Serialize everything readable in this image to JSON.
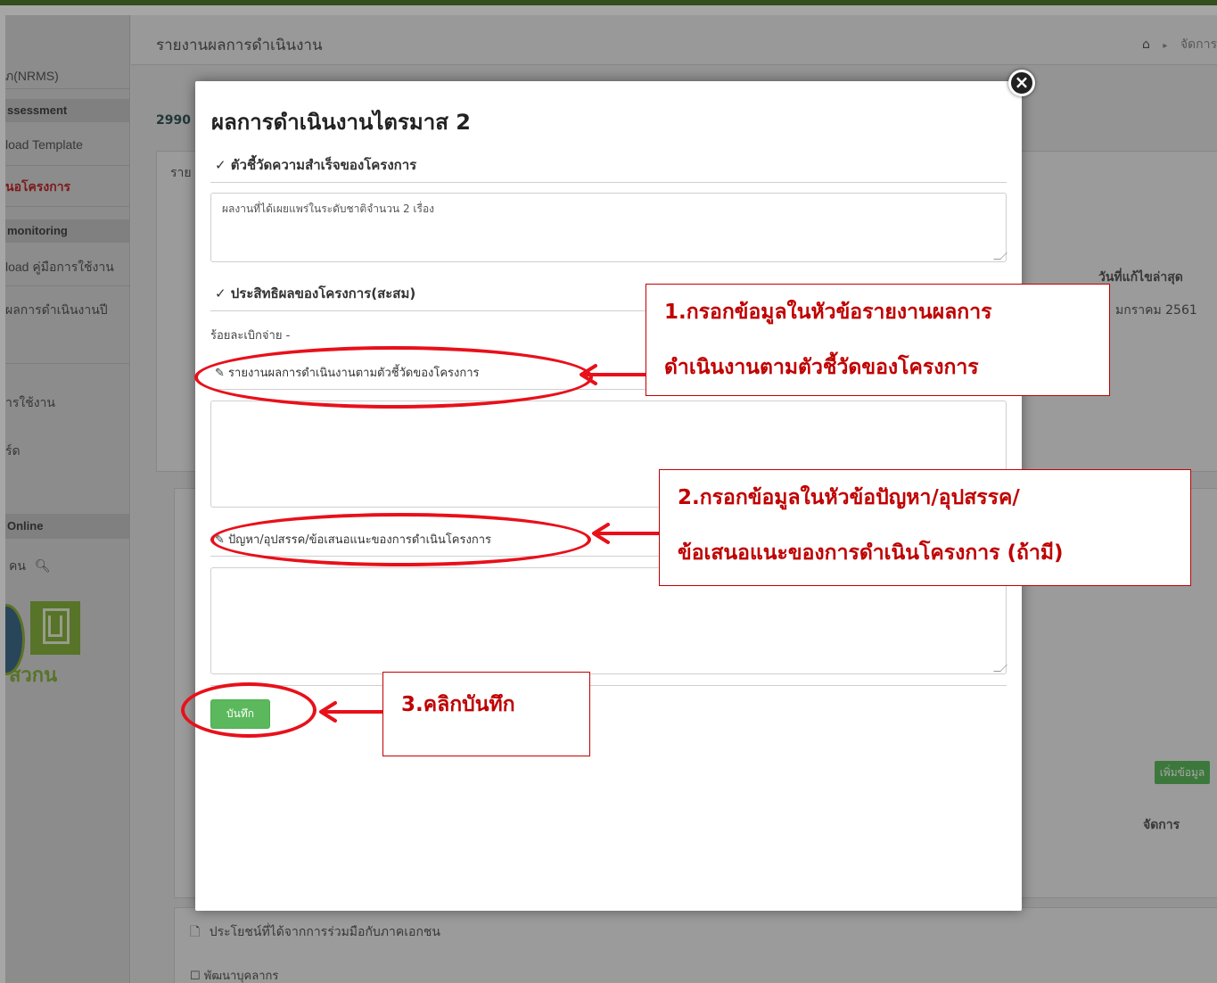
{
  "sidebar": {
    "items": [
      {
        "label": "ภ(NRMS)",
        "type": "item"
      },
      {
        "label": "ssessment",
        "type": "section"
      },
      {
        "label": "load Template",
        "type": "item"
      },
      {
        "label": "นอโครงการ",
        "type": "active"
      },
      {
        "label": "monitoring",
        "type": "section"
      },
      {
        "label": "load คู่มือการใช้งาน",
        "type": "item"
      },
      {
        "label": "ผลการดำเนินงานปี",
        "type": "item"
      },
      {
        "label": "ารใช้งาน",
        "type": "item"
      },
      {
        "label": "ร์ด",
        "type": "item"
      },
      {
        "label": "Online",
        "type": "section"
      },
      {
        "label": "คน",
        "type": "item"
      }
    ],
    "logo_text": "สวกน"
  },
  "page": {
    "title": "รายงานผลการดำเนินงาน",
    "breadcrumb": "จัดการ",
    "bg_code": "2990",
    "bg_tab": "ราย",
    "bg_col_date": "วันที่แก้ไขล่าสุด",
    "bg_date_value": "มกราคม 2561",
    "bg_col_manage": "จัดการ",
    "bg_add_button": "เพิ่มข้อมูล",
    "bg_section_private": "ประโยชน์ที่ได้จากการร่วมมือกับภาคเอกชน",
    "bg_option": "พัฒนาบุคลากร"
  },
  "modal": {
    "title": "ผลการดำเนินงานไตรมาส 2",
    "section1_heading": "✓ ตัวชี้วัดความสำเร็จของโครงการ",
    "kpi_value": "ผลงานที่ได้เผยแพร่ในระดับชาติจำนวน 2 เรื่อง",
    "section2_heading": "✓ ประสิทธิผลของโครงการ(สะสม)",
    "disbursement_text": "ร้อยละเบิกจ่าย -",
    "report_label": "รายงานผลการดำเนินงานตามตัวชี้วัดของโครงการ",
    "report_value": "",
    "problem_label": "ปัญหา/อุปสรรค/ข้อเสนอแนะของการดำเนินโครงการ",
    "problem_value": "",
    "save_button": "บันทึก",
    "close_symbol": "×"
  },
  "annotations": {
    "step1_line1": "1.กรอกข้อมูลในหัวข้อรายงานผลการ",
    "step1_line2": "ดำเนินงานตามตัวชี้วัดของโครงการ",
    "step2_line1": "2.กรอกข้อมูลในหัวข้อปัญหา/อุปสรรค/",
    "step2_line2": "ข้อเสนอแนะของการดำเนินโครงการ (ถ้ามี)",
    "step3": "3.คลิกบันทึก",
    "color": "#e8101a"
  },
  "colors": {
    "top_bar": "#4f7a2e",
    "save_button": "#5cb85c",
    "active_menu": "#c02727"
  }
}
